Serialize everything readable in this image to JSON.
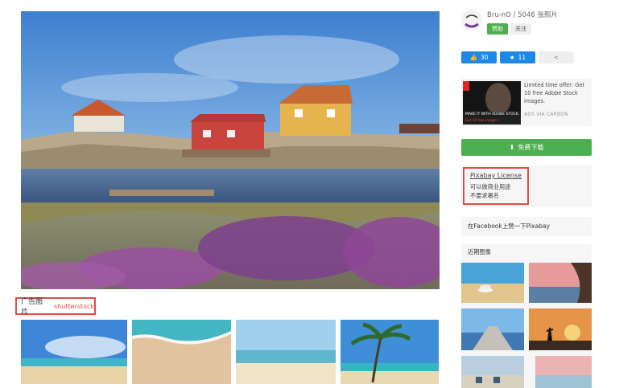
{
  "ad_section": {
    "label": "广告图片",
    "brand": "shutterstock"
  },
  "author": {
    "name": "Bru-nO / 5046 张照片",
    "follow_label": "赞助",
    "watch_label": "关注"
  },
  "stats": {
    "likes": "30",
    "favorites": "11"
  },
  "adobe_ad": {
    "text": "Limited time offer: Get 10 free Adobe Stock images.",
    "via": "ADS VIA CARBON",
    "banner_headline": "MAKE IT WITH ADOBE STOCK.",
    "banner_sub": "Get 10 free images ›"
  },
  "download": {
    "label": "免费下载"
  },
  "license": {
    "title": "Pixabay License",
    "line1": "可以做商业用途",
    "line2": "不要求署名"
  },
  "facebook": {
    "label": "在Facebook上赞一下Pixabay"
  },
  "recent": {
    "title": "近期图像"
  },
  "colors": {
    "green": "#4caf50",
    "blue": "#1e88e5",
    "highlight_red": "#e24b4b"
  }
}
